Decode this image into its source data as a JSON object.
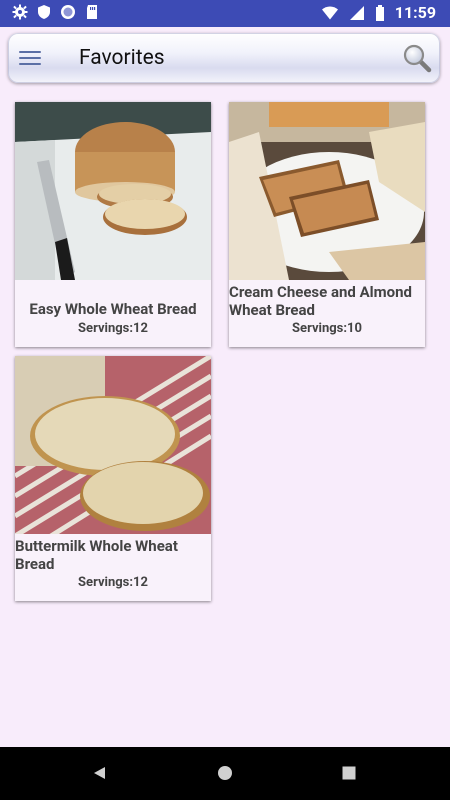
{
  "status_bar": {
    "time": "11:59",
    "left_icons": [
      "gear-icon",
      "shield-icon",
      "circle-icon",
      "sd-card-icon"
    ],
    "right_icons": [
      "wifi-icon",
      "signal-icon",
      "battery-icon"
    ]
  },
  "app_bar": {
    "title": "Favorites",
    "menu_icon": "hamburger-menu-icon",
    "search_icon": "search-icon"
  },
  "recipes": [
    {
      "title": "Easy Whole Wheat Bread",
      "servings": "Servings:12",
      "align": "center"
    },
    {
      "title": "Cream Cheese and Almond Wheat Bread",
      "servings": "Servings:10",
      "align": "left"
    },
    {
      "title": "Buttermilk Whole Wheat Bread",
      "servings": "Servings:12",
      "align": "left"
    }
  ],
  "nav_bar": {
    "buttons": [
      "back-icon",
      "home-icon",
      "recents-icon"
    ]
  },
  "colors": {
    "status_bar": "#3d4bb5",
    "background": "#f8ecfb",
    "card": "#f9f2fb",
    "text": "#444444"
  }
}
